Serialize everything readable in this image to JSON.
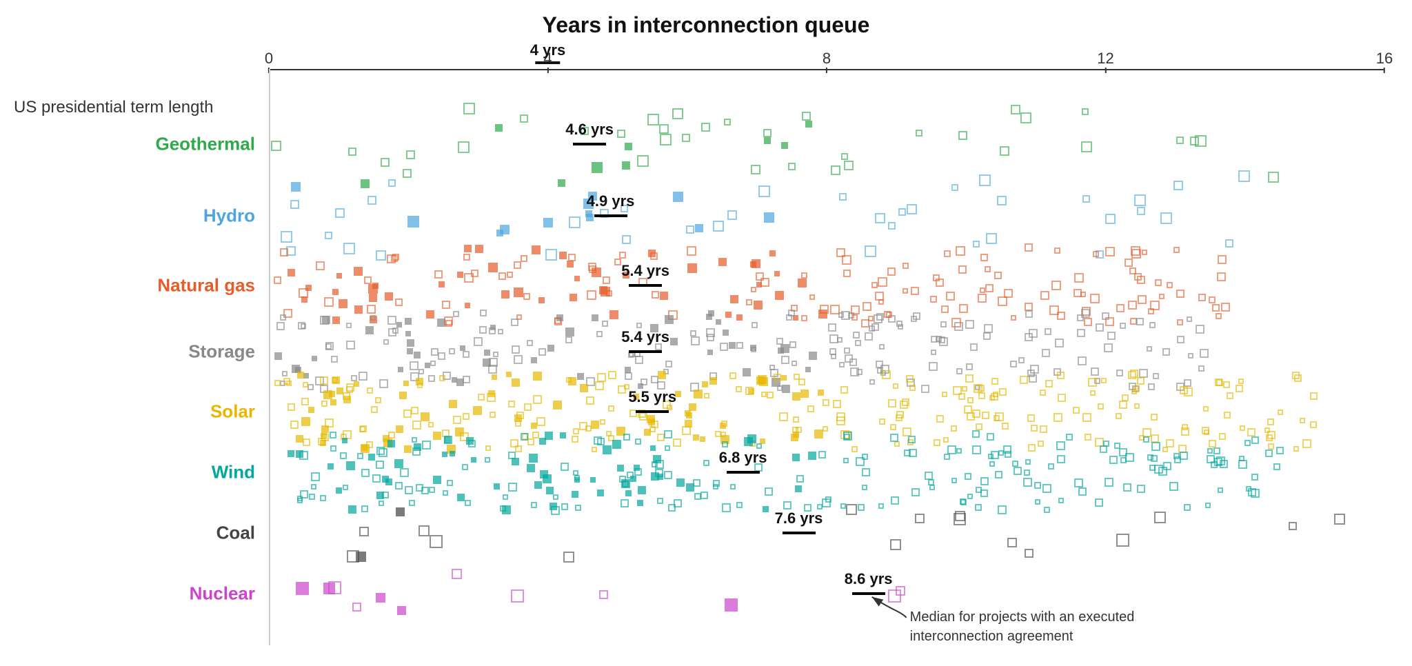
{
  "title": "Years in interconnection queue",
  "us_term_label": "US presidential term length",
  "axis": {
    "ticks": [
      0,
      4,
      8,
      12,
      16
    ]
  },
  "annotation": {
    "text": "Median for projects with an executed\ninterconnection agreement"
  },
  "rows": [
    {
      "label": "Geothermal",
      "color": "#2eaa4a",
      "median": 4.6,
      "median_label": "4.6 yrs",
      "y_center": 0.13
    },
    {
      "label": "Hydro",
      "color": "#4da6e0",
      "median": 4.9,
      "median_label": "4.9 yrs",
      "y_center": 0.255
    },
    {
      "label": "Natural gas",
      "color": "#e85c2a",
      "median": 5.4,
      "median_label": "5.4 yrs",
      "y_center": 0.375
    },
    {
      "label": "Storage",
      "color": "#888888",
      "median": 5.4,
      "median_label": "5.4 yrs",
      "y_center": 0.49
    },
    {
      "label": "Solar",
      "color": "#e8b800",
      "median": 5.5,
      "median_label": "5.5 yrs",
      "y_center": 0.595
    },
    {
      "label": "Wind",
      "color": "#00a89d",
      "median": 6.8,
      "median_label": "6.8 yrs",
      "y_center": 0.7
    },
    {
      "label": "Coal",
      "color": "#444444",
      "median": 7.6,
      "median_label": "7.6 yrs",
      "y_center": 0.805
    },
    {
      "label": "Nuclear",
      "color": "#cc44cc",
      "median": 8.6,
      "median_label": "8.6 yrs",
      "y_center": 0.91
    }
  ]
}
